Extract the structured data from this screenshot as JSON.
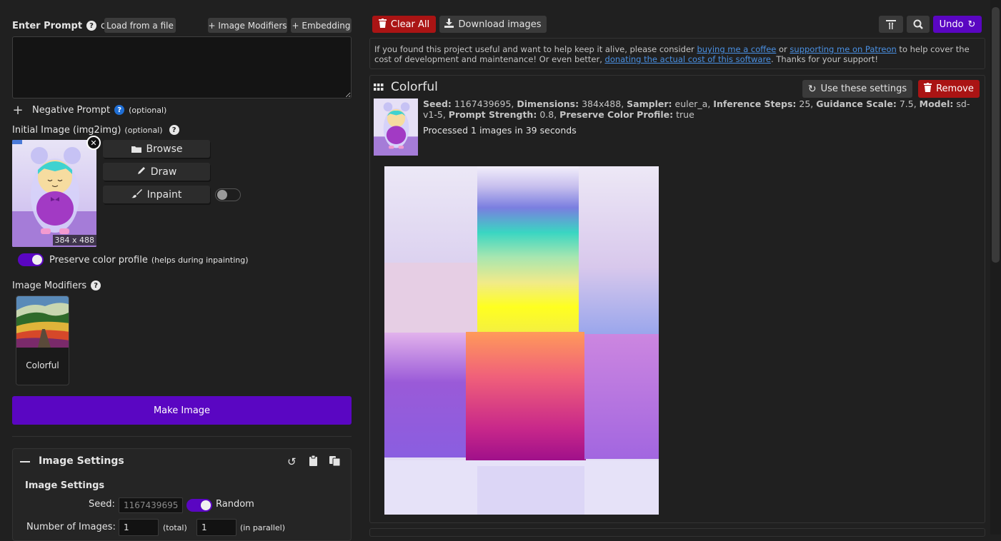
{
  "prompt": {
    "label": "Enter Prompt",
    "or_text": "or",
    "load_file": "Load from a file",
    "image_modifiers_btn": "+ Image Modifiers",
    "embedding_btn": "+ Embedding",
    "value": ""
  },
  "negative": {
    "plus": "+",
    "label": "Negative Prompt",
    "optional": "(optional)"
  },
  "init_image": {
    "label": "Initial Image (img2img)",
    "optional": "(optional)",
    "size_badge": "384 x 488",
    "browse": "Browse",
    "draw": "Draw",
    "inpaint": "Inpaint"
  },
  "preserve": {
    "label": "Preserve color profile",
    "hint": "(helps during inpainting)"
  },
  "modifiers": {
    "label": "Image Modifiers",
    "card_label": "Colorful"
  },
  "make_image": "Make Image",
  "settings": {
    "header": "Image Settings",
    "subheader": "Image Settings",
    "seed_label": "Seed:",
    "seed_value": "1167439695",
    "random_label": "Random",
    "num_images_label": "Number of Images:",
    "num_total": "1",
    "total_hint": "(total)",
    "num_parallel": "1",
    "parallel_hint": "(in parallel)"
  },
  "toolbar": {
    "clear_all": "Clear All",
    "download": "Download images",
    "undo": "Undo"
  },
  "support": {
    "t1": "If you found this project useful and want to help keep it alive, please consider ",
    "link1": "buying me a coffee",
    "t2": " or ",
    "link2": "supporting me on Patreon",
    "t3": " to help cover the cost of development and maintenance! Or even better, ",
    "link3": "donating the actual cost of this software",
    "t4": ". Thanks for your support!"
  },
  "result": {
    "title": "Colorful",
    "use_settings": "Use these settings",
    "remove": "Remove",
    "seed_k": "Seed:",
    "seed_v": "1167439695,",
    "dim_k": "Dimensions:",
    "dim_v": "384x488,",
    "sampler_k": "Sampler:",
    "sampler_v": "euler_a,",
    "steps_k": "Inference Steps:",
    "steps_v": "25,",
    "guidance_k": "Guidance Scale:",
    "guidance_v": "7.5,",
    "model_k": "Model:",
    "model_v": "sd-v1-5,",
    "strength_k": "Prompt Strength:",
    "strength_v": "0.8,",
    "pcp_k": "Preserve Color Profile:",
    "pcp_v": "true",
    "processed": "Processed 1 images in 39 seconds"
  },
  "colors": {
    "accent": "#5a06c2",
    "danger": "#aa1414",
    "link": "#4a90e2",
    "background": "#202020"
  }
}
